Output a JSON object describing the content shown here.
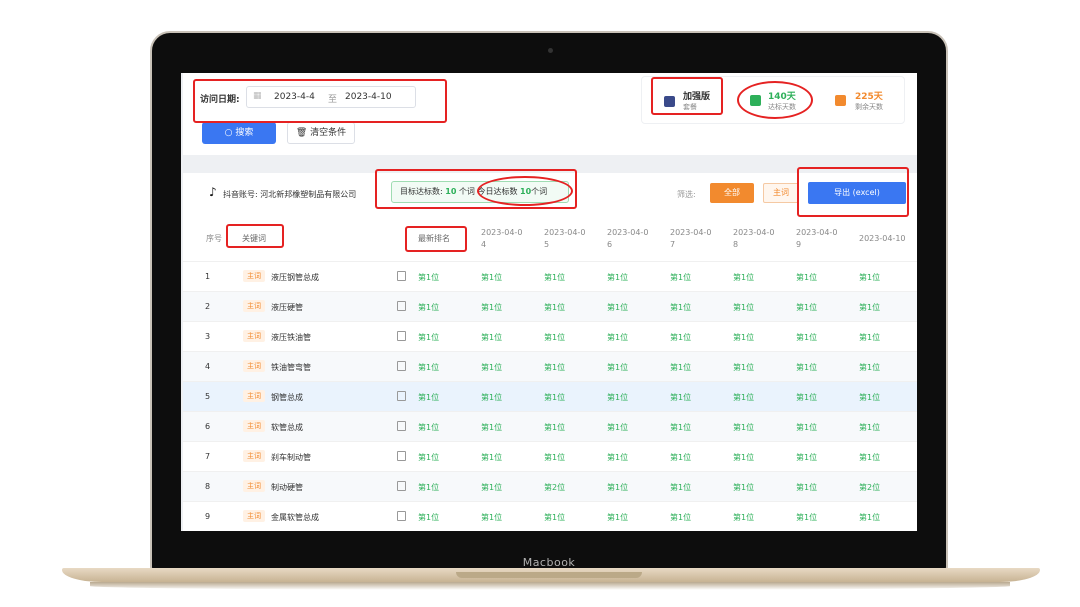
{
  "laptop": {
    "brand": "Macbook"
  },
  "filters": {
    "visit_date_label": "访问日期:",
    "start_date": "2023-4-4",
    "range_sep": "至",
    "end_date": "2023-4-10",
    "search_label": "搜索",
    "clear_label": "清空条件"
  },
  "stats": {
    "plan_name": "加强版",
    "plan_sub": "套餐",
    "reached_value": "140天",
    "reached_sub": "达标天数",
    "remaining_value": "225天",
    "remaining_sub": "剩余天数"
  },
  "account": {
    "label": "抖音账号: 河北新邦橡塑制品有限公司",
    "goal_label": "目标达标数:",
    "goal_value": "10",
    "goal_unit": "个词",
    "today_label": "今日达标数",
    "today_value": "10",
    "today_unit": "个词"
  },
  "actions": {
    "filter_label": "筛选:",
    "all_label": "全部",
    "main_label": "主词",
    "export_label": "导出 (excel)"
  },
  "table": {
    "headers": {
      "index": "序号",
      "keyword": "关键词",
      "latest": "最新排名",
      "d4a": "2023-04-0",
      "d4b": "4",
      "d5a": "2023-04-0",
      "d5b": "5",
      "d6a": "2023-04-0",
      "d6b": "6",
      "d7a": "2023-04-0",
      "d7b": "7",
      "d8a": "2023-04-0",
      "d8b": "8",
      "d9a": "2023-04-0",
      "d9b": "9",
      "d10": "2023-04-10"
    },
    "tag": "主词",
    "rows": [
      {
        "idx": "1",
        "kw": "液压钢管总成",
        "r": [
          "第1位",
          "第1位",
          "第1位",
          "第1位",
          "第1位",
          "第1位",
          "第1位",
          "第1位"
        ]
      },
      {
        "idx": "2",
        "kw": "液压硬管",
        "r": [
          "第1位",
          "第1位",
          "第1位",
          "第1位",
          "第1位",
          "第1位",
          "第1位",
          "第1位"
        ]
      },
      {
        "idx": "3",
        "kw": "液压铁油管",
        "r": [
          "第1位",
          "第1位",
          "第1位",
          "第1位",
          "第1位",
          "第1位",
          "第1位",
          "第1位"
        ]
      },
      {
        "idx": "4",
        "kw": "铁油管弯管",
        "r": [
          "第1位",
          "第1位",
          "第1位",
          "第1位",
          "第1位",
          "第1位",
          "第1位",
          "第1位"
        ]
      },
      {
        "idx": "5",
        "kw": "钢管总成",
        "r": [
          "第1位",
          "第1位",
          "第1位",
          "第1位",
          "第1位",
          "第1位",
          "第1位",
          "第1位"
        ]
      },
      {
        "idx": "6",
        "kw": "软管总成",
        "r": [
          "第1位",
          "第1位",
          "第1位",
          "第1位",
          "第1位",
          "第1位",
          "第1位",
          "第1位"
        ]
      },
      {
        "idx": "7",
        "kw": "刹车制动管",
        "r": [
          "第1位",
          "第1位",
          "第1位",
          "第1位",
          "第1位",
          "第1位",
          "第1位",
          "第1位"
        ]
      },
      {
        "idx": "8",
        "kw": "制动硬管",
        "r": [
          "第1位",
          "第1位",
          "第2位",
          "第1位",
          "第1位",
          "第1位",
          "第1位",
          "第2位"
        ]
      },
      {
        "idx": "9",
        "kw": "金属软管总成",
        "r": [
          "第1位",
          "第1位",
          "第1位",
          "第1位",
          "第1位",
          "第1位",
          "第1位",
          "第1位"
        ]
      }
    ]
  }
}
